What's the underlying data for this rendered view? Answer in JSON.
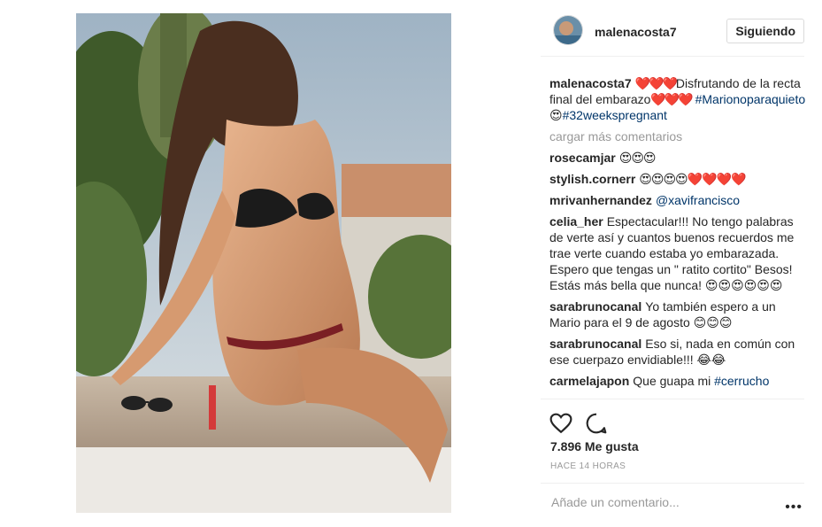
{
  "post": {
    "image_alt": "Foto de malenacosta7",
    "likes": "7.896 Me gusta",
    "timestamp": "HACE 14 HORAS"
  },
  "header": {
    "username": "malenacosta7",
    "follow_label": "Siguiendo"
  },
  "caption": {
    "user": "malenacosta7",
    "hearts1": "❤️❤️❤️",
    "text1": "Disfrutando de la recta final del embarazo",
    "hearts2": "❤️❤️❤️",
    "hashtag1": "#Marionoparaquieto",
    "emoji": "😍",
    "hashtag2": "#32weekspregnant"
  },
  "load_more": "cargar más comentarios",
  "comments": [
    {
      "user": "rosecamjar",
      "text": "😍😍😍"
    },
    {
      "user": "stylish.cornerr",
      "text": "😍😍😍😍❤️❤️❤️❤️"
    },
    {
      "user": "mrivanhernandez",
      "mention": "@xavifrancisco"
    },
    {
      "user": "celia_her",
      "text": "Espectacular!!! No tengo palabras de verte así y cuantos buenos recuerdos me trae verte cuando estaba yo embarazada. Espero que tengas un \" ratito cortito\" Besos! Estás más bella que nunca! 😍😍😍😍😍😍"
    },
    {
      "user": "sarabrunocanal",
      "text": "Yo también espero a un Mario para el 9 de agosto 😊😊😊"
    },
    {
      "user": "sarabrunocanal",
      "text": "Eso si, nada en común con ese cuerpazo envidiable!!! 😂😂"
    },
    {
      "user": "carmelajapon",
      "text": "Que guapa mi",
      "mention": "#cerrucho"
    }
  ],
  "add_comment": {
    "placeholder": "Añade un comentario..."
  },
  "icons": {
    "like": "heart-outline-icon",
    "comment": "speech-bubble-icon",
    "more": "more-options-icon"
  }
}
